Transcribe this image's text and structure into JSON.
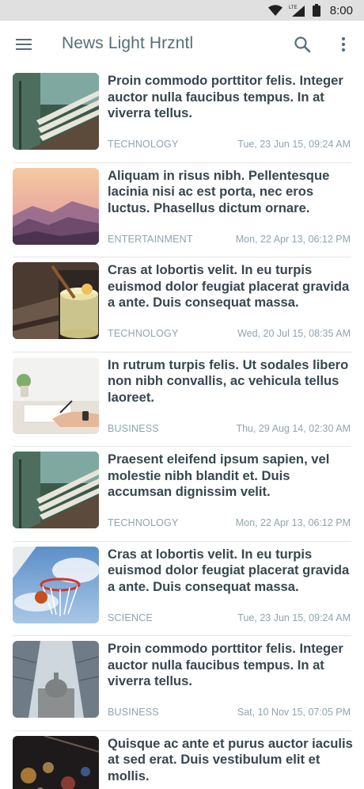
{
  "status_bar": {
    "network": "LTE",
    "time": "8:00"
  },
  "app_bar": {
    "title": "News Light Hrzntl",
    "icons": [
      "menu-icon",
      "search-icon",
      "more-vert-icon"
    ]
  },
  "articles": [
    {
      "image": "bench",
      "headline": "Proin commodo porttitor felis. Integer auctor nulla faucibus tempus. In at viverra tellus.",
      "category": "TECHNOLOGY",
      "date": "Tue, 23 Jun 15, 09:24 AM"
    },
    {
      "image": "sunset-mountains",
      "headline": "Aliquam in risus nibh. Pellentesque lacinia nisi ac est porta, nec eros luctus. Phasellus dictum ornare.",
      "category": "ENTERTAINMENT",
      "date": "Mon, 22 Apr 13, 06:12 PM"
    },
    {
      "image": "cocktail",
      "headline": "Cras at lobortis velit. In eu turpis euismod dolor feugiat placerat gravida a ante. Duis consequat massa.",
      "category": "TECHNOLOGY",
      "date": "Wed, 20 Jul 15, 08:35 AM"
    },
    {
      "image": "writing-desk",
      "headline": "In rutrum turpis felis. Ut sodales libero non nibh convallis, ac vehicula tellus laoreet.",
      "category": "BUSINESS",
      "date": "Thu, 29 Aug 14, 02:30 AM"
    },
    {
      "image": "bench",
      "headline": "Praesent eleifend ipsum sapien, vel molestie nibh blandit et. Duis accumsan dignissim velit.",
      "category": "TECHNOLOGY",
      "date": "Mon, 22 Apr 13, 06:12 PM"
    },
    {
      "image": "basketball-hoop",
      "headline": "Cras at lobortis velit. In eu turpis euismod dolor feugiat placerat gravida a ante. Duis consequat massa.",
      "category": "SCIENCE",
      "date": "Tue, 23 Jun 15, 09:24 AM"
    },
    {
      "image": "cathedral",
      "headline": "Proin commodo porttitor felis. Integer auctor nulla faucibus tempus. In at viverra tellus.",
      "category": "BUSINESS",
      "date": "Sat, 10 Nov 15, 07:05 PM"
    },
    {
      "image": "bokeh-lights",
      "headline": "Quisque ac ante et purus auctor iaculis at sed erat. Duis vestibulum elit et mollis.",
      "category": "",
      "date": ""
    }
  ]
}
